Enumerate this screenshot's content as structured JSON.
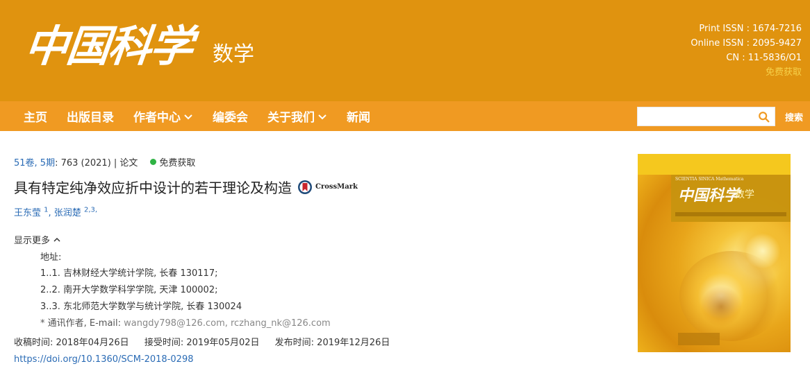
{
  "header": {
    "logo_text": "中国科学",
    "logo_sub": "数学",
    "print_issn": "Print ISSN : 1674-7216",
    "online_issn": "Online ISSN : 2095-9427",
    "cn": "CN : 11-5836/O1",
    "free_access": "免费获取"
  },
  "nav": {
    "items": [
      {
        "label": "主页",
        "dropdown": false
      },
      {
        "label": "出版目录",
        "dropdown": false
      },
      {
        "label": "作者中心",
        "dropdown": true
      },
      {
        "label": "编委会",
        "dropdown": false
      },
      {
        "label": "关于我们",
        "dropdown": true
      },
      {
        "label": "新闻",
        "dropdown": false
      }
    ],
    "search_value": "",
    "search_placeholder": "",
    "search_button": "搜索"
  },
  "article": {
    "volume_issue": "51卷, 5期",
    "pages_year": ": 763 (2021) | 论文",
    "free_badge": "免费获取",
    "title": "具有特定纯净效应折中设计的若干理论及构造",
    "crossmark": "CrossMark",
    "authors": [
      {
        "name": "王东莹",
        "sup": "1"
      },
      {
        "name": "张润楚",
        "sup": "2,3,"
      }
    ],
    "show_more": "显示更多",
    "address_label": "地址:",
    "affiliations": [
      "1..1. 吉林财经大学统计学院, 长春 130117;",
      "2..2. 南开大学数学科学学院, 天津 100002;",
      "3..3. 东北师范大学数学与统计学院, 长春 130024"
    ],
    "corresponding_label": "* 通讯作者, E-mail: ",
    "corresponding_emails": "wangdy798@126.com, rczhang_nk@126.com",
    "received": "收稿时间: 2018年04月26日",
    "accepted": "接受时间: 2019年05月02日",
    "published": "发布时间: 2019年12月26日",
    "doi": "https://doi.org/10.1360/SCM-2018-0298"
  },
  "cover": {
    "series_en": "SCIENTIA SINICA Mathematica",
    "title_cn": "中国科学",
    "subject_cn": "数学"
  },
  "colors": {
    "header_bg": "#e0930f",
    "nav_bg": "#f09a22",
    "link_blue": "#2a6bb5",
    "free_green": "#2fb344"
  }
}
